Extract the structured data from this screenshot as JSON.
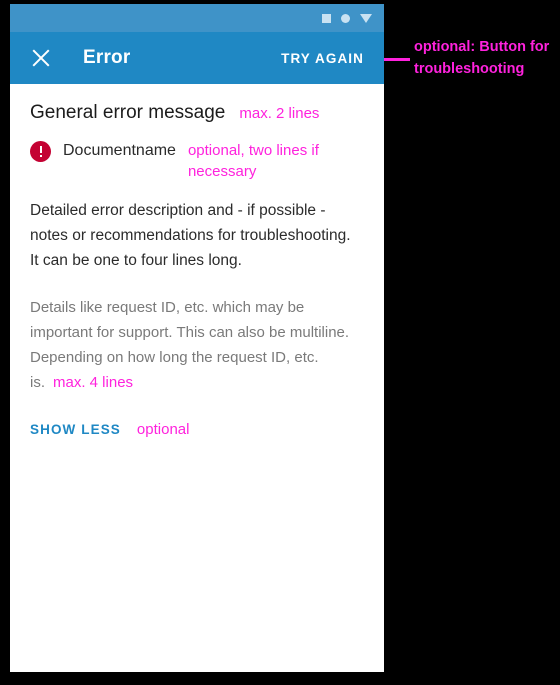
{
  "status_bar": {
    "icons": [
      "square-icon",
      "circle-icon",
      "triangle-down-icon"
    ]
  },
  "app_bar": {
    "close_icon": "close-icon",
    "title": "Error",
    "try_again_label": "TRY AGAIN",
    "background_color": "#1f88c4"
  },
  "content": {
    "heading": "General error message",
    "heading_note": "max. 2 lines",
    "error_badge_icon": "error-exclamation-icon",
    "document_name": "Documentname",
    "document_name_note": "optional, two lines if necessary",
    "description": "Detailed error description and - if possible - notes or recommendations for troubleshooting.\nIt can be one to four lines long.",
    "details_text": "Details like request ID, etc. which may be important for support. This can also be multiline. Depending on how long the request ID, etc. is.",
    "details_note": "max. 4 lines",
    "show_less_label": "SHOW LESS",
    "show_less_note": "optional"
  },
  "annotations": {
    "try_again_note": "optional: Button for troubleshooting",
    "note_color": "#ff22dd"
  }
}
